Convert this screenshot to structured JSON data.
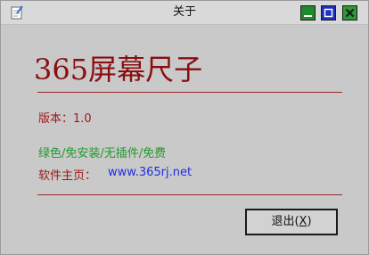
{
  "window": {
    "title": "关于"
  },
  "titlebar": {
    "app_icon": "notepad-icon",
    "controls": [
      {
        "name": "minimize-icon",
        "color": "#1e8a2e"
      },
      {
        "name": "maximize-icon",
        "color": "#1f2fbf"
      },
      {
        "name": "close-icon",
        "color": "#2a9a35"
      }
    ]
  },
  "about": {
    "app_name": "365屏幕尺子",
    "version": "版本：1.0",
    "features": "绿色/免安装/无插件/免费",
    "homepage_label": "软件主页：",
    "homepage_url": "www.365rj.net"
  },
  "buttons": {
    "exit_label": "退出(",
    "exit_mnemonic": "X",
    "exit_close": ")"
  },
  "colors": {
    "app_name": "#8a0e10",
    "text_red": "#a01818",
    "text_green": "#1f9a2a",
    "link_blue": "#1d2fe0",
    "background": "#c9c9c9"
  }
}
